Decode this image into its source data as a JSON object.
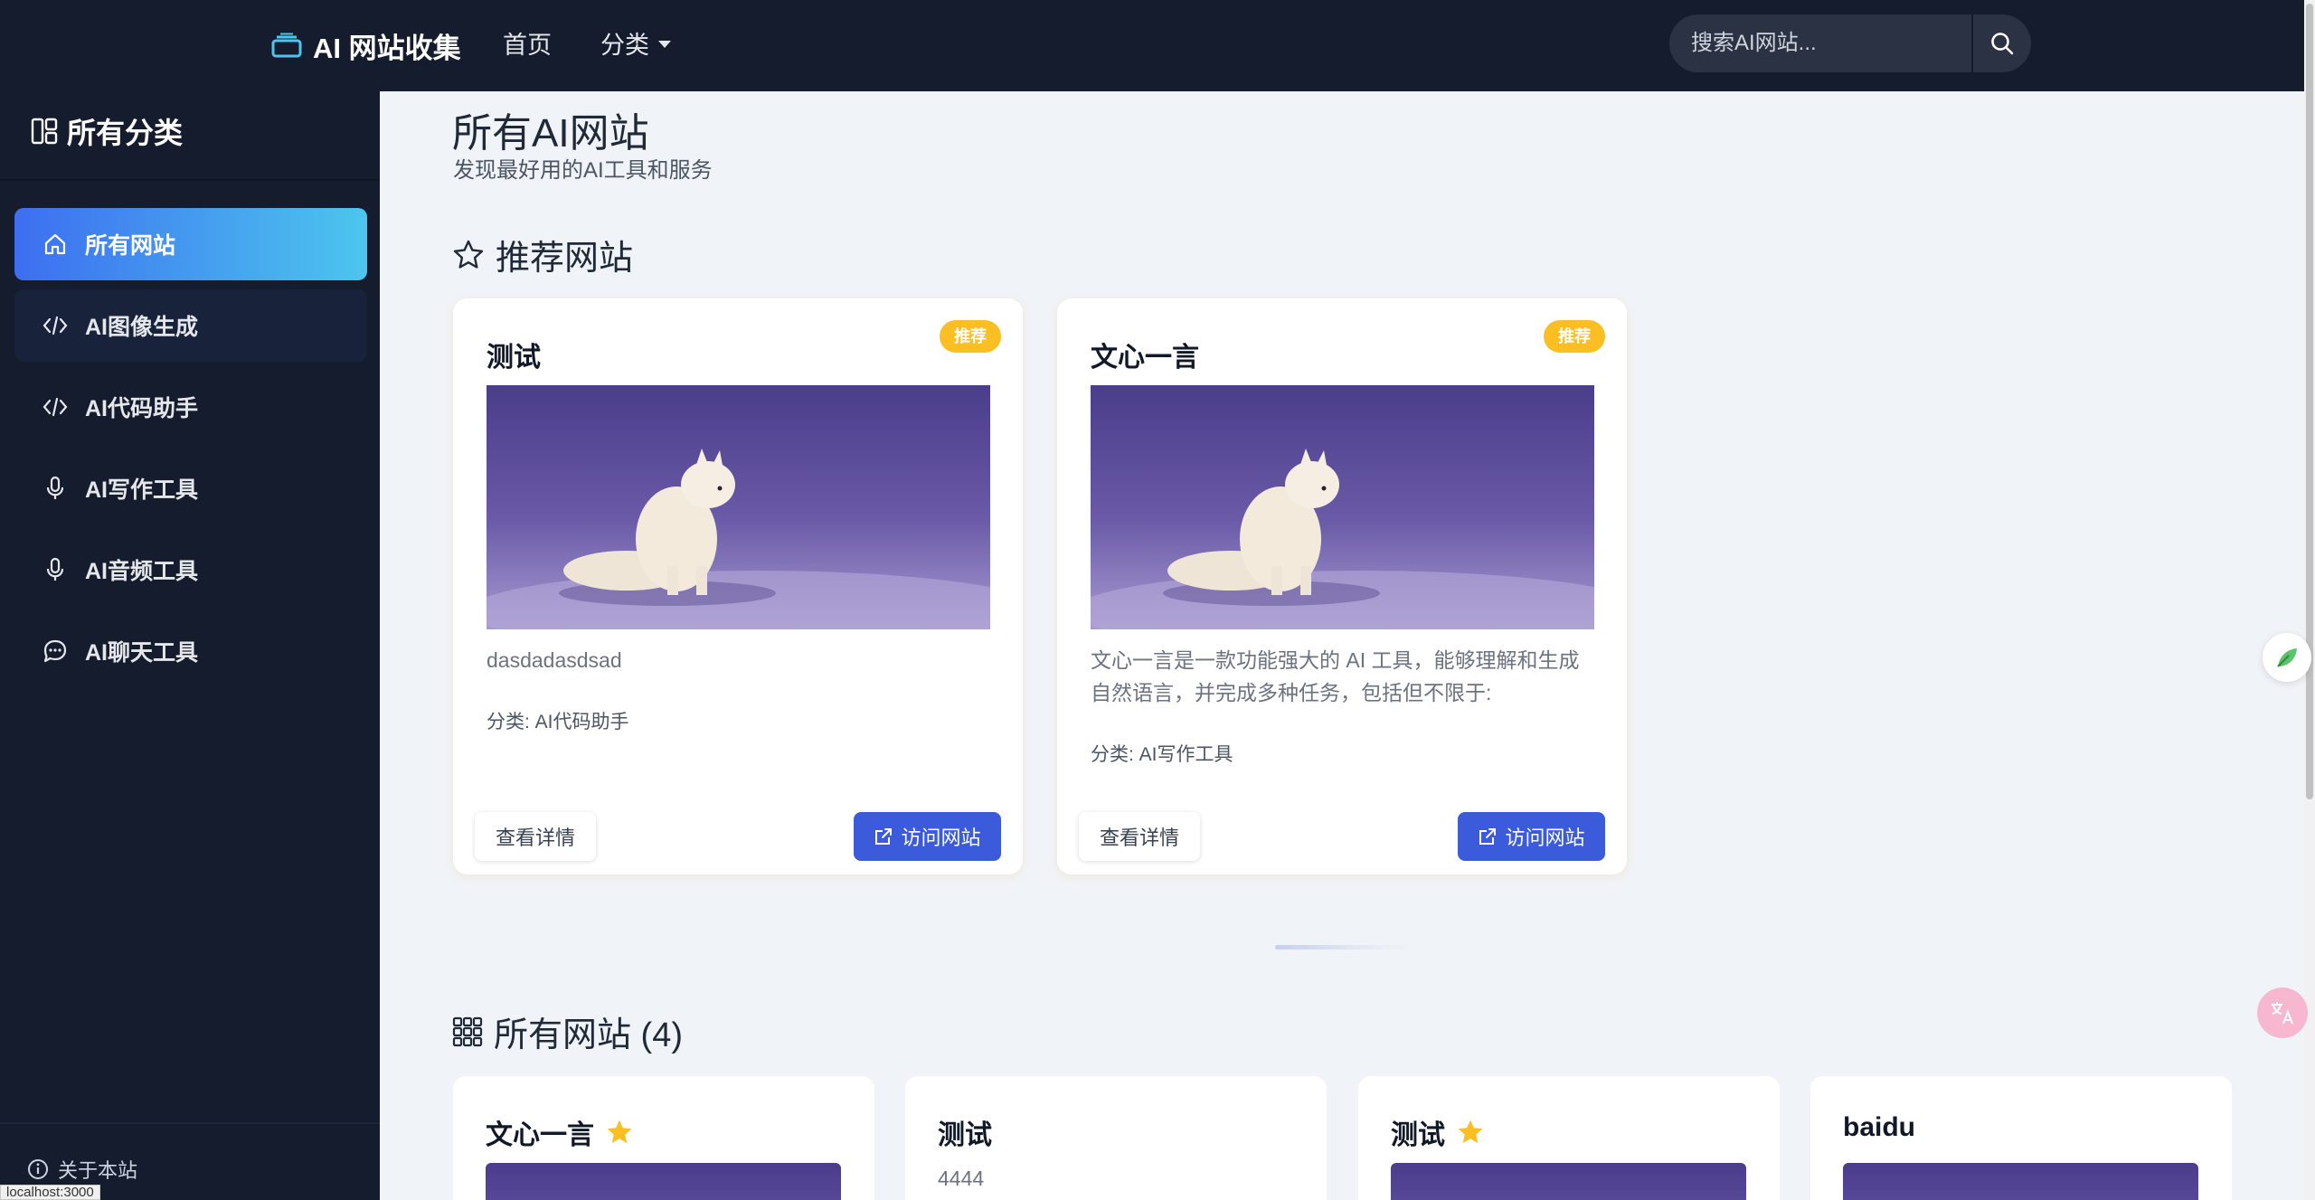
{
  "navbar": {
    "brand": "AI 网站收集",
    "links": [
      "首页",
      "分类"
    ],
    "search_placeholder": "搜索AI网站..."
  },
  "sidebar": {
    "title": "所有分类",
    "items": [
      {
        "label": "所有网站",
        "icon": "home-icon"
      },
      {
        "label": "AI图像生成",
        "icon": "code-icon"
      },
      {
        "label": "AI代码助手",
        "icon": "code-icon"
      },
      {
        "label": "AI写作工具",
        "icon": "microphone-icon"
      },
      {
        "label": "AI音频工具",
        "icon": "microphone-icon"
      },
      {
        "label": "AI聊天工具",
        "icon": "chat-icon"
      }
    ],
    "about": "关于本站",
    "status_url": "localhost:3000"
  },
  "main": {
    "title": "所有AI网站",
    "subtitle": "发现最好用的AI工具和服务",
    "recommended": {
      "title": "推荐网站",
      "cards": [
        {
          "title": "测试",
          "badge": "推荐",
          "desc": "dasdadasdsad",
          "category": "分类: AI代码助手",
          "detail_label": "查看详情",
          "visit_label": "访问网站"
        },
        {
          "title": "文心一言",
          "badge": "推荐",
          "desc": "文心一言是一款功能强大的 AI 工具，能够理解和生成自然语言，并完成多种任务，包括但不限于:",
          "category": "分类: AI写作工具",
          "detail_label": "查看详情",
          "visit_label": "访问网站"
        }
      ]
    },
    "all": {
      "title": "所有网站 (4)",
      "cards": [
        {
          "title": "文心一言",
          "starred": true
        },
        {
          "title": "测试",
          "starred": false,
          "desc": "4444"
        },
        {
          "title": "测试",
          "starred": true
        },
        {
          "title": "baidu",
          "starred": false
        }
      ]
    }
  },
  "colors": {
    "navbar_bg": "#141c2e",
    "accent_blue": "#3b5bdb",
    "badge_yellow": "#fbbf24",
    "active_gradient_start": "#3d6ef0",
    "active_gradient_end": "#4cc6ee"
  }
}
